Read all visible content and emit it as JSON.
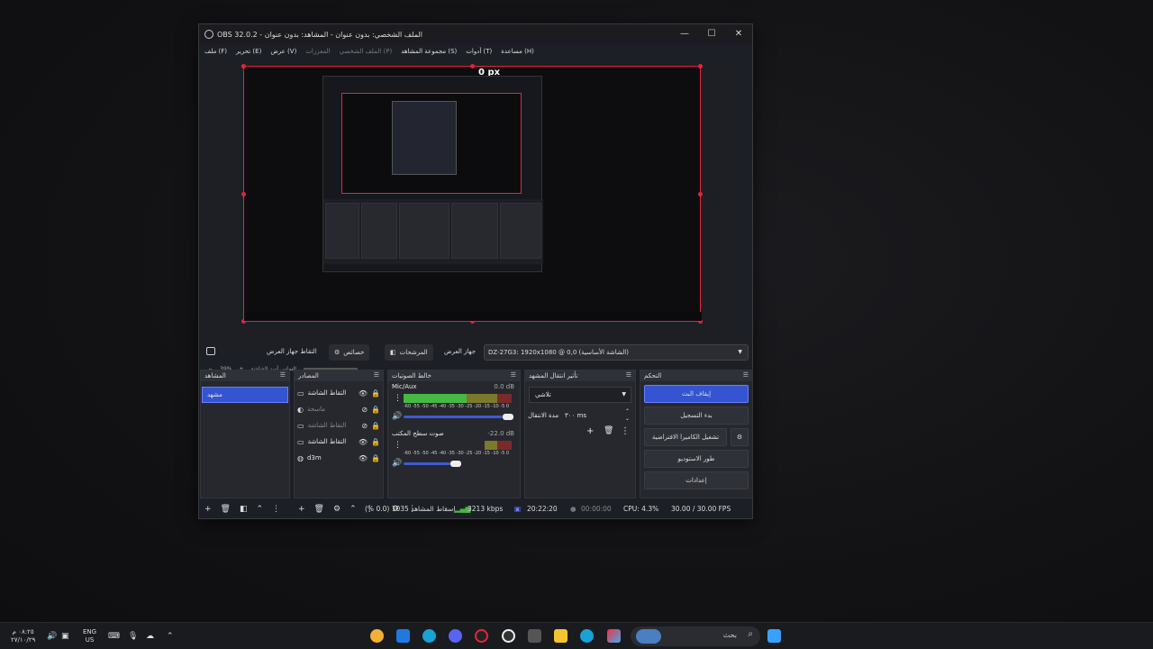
{
  "window": {
    "title": "OBS 32.0.2 - الملف الشخصي: بدون عنوان - المشاهد: بدون عنوان",
    "controls": [
      "—",
      "☐",
      "✕"
    ]
  },
  "menu": [
    {
      "label": "ملف (F)",
      "enabled": true
    },
    {
      "label": "تحرير (E)",
      "enabled": true
    },
    {
      "label": "عرض (V)",
      "enabled": true
    },
    {
      "label": "المعززات",
      "enabled": false
    },
    {
      "label": "الملف الشخصي (P)",
      "enabled": false
    },
    {
      "label": "مجموعة المشاهد (S)",
      "enabled": true
    },
    {
      "label": "أدوات (T)",
      "enabled": true
    },
    {
      "label": "مساعدة (H)",
      "enabled": true
    }
  ],
  "preview": {
    "px_label": "0 px",
    "zoom": "39%",
    "zoom_minus": "−",
    "zoom_plus": "+",
    "zoom_hint": "التماس أسد الشاشة"
  },
  "scene_bar": {
    "capture_label": "التقاط جهاز العرض",
    "properties_label": "خصائص",
    "filters_label": "المرشحات",
    "device_label": "جهاز العرض",
    "device_value": "DZ-27G3: 1920x1080 @ 0,0 (الشاشة الأساسية)"
  },
  "docks": {
    "scenes": {
      "title": "المشاهد",
      "items": [
        "مشهد"
      ]
    },
    "sources": {
      "title": "المصادر",
      "items": [
        {
          "name": "التقاط الشاشة",
          "visible": true,
          "locked": true
        },
        {
          "name": "ماسحة",
          "visible": false,
          "locked": true
        },
        {
          "name": "التقاط الشاشة",
          "visible": false,
          "locked": true
        },
        {
          "name": "التقاط الشاشة",
          "visible": true,
          "locked": true
        },
        {
          "name": "d3m",
          "visible": true,
          "locked": true
        }
      ]
    },
    "mixer": {
      "title": "خالط الصوتيات",
      "channels": [
        {
          "name": "Mic/Aux",
          "db": "0.0 dB",
          "level": 0.7
        },
        {
          "name": "صوت سطح المكتب",
          "db": "-22.0 dB",
          "level": 0.45
        }
      ],
      "scale": "-60 -55 -50 -45 -40 -35 -30 -25 -20 -15 -10 -5 0"
    },
    "transitions": {
      "title": "تأثير انتقال المشهد",
      "type": "تلاشي",
      "duration_label": "مدة الانتقال",
      "duration_value": "٣٠٠ ms"
    },
    "controls": {
      "title": "التحكم",
      "buttons": [
        "إيقاف البث",
        "بدء التسجيل",
        "تشغيل الكاميرا الافتراضية",
        "طور الاستوديو",
        "إعدادات"
      ]
    }
  },
  "status": {
    "dropped": "إسقاط المشاهد 1035 (0.0 %)",
    "bitrate": "3213 kbps",
    "stream_time": "20:22:20",
    "rec_time": "00:00:00",
    "cpu": "CPU: 4.3%",
    "fps": "30.00 / 30.00 FPS"
  },
  "taskbar": {
    "search_placeholder": "بحث",
    "lang_top": "ENG",
    "lang_bottom": "US",
    "time": "٠٨:٢٥ م",
    "date": "٢٧/١٠/٢٩",
    "colors": {
      "chrome": "#f2b134",
      "store": "#1f7ae0",
      "edge": "#1aa2d6",
      "obs": "#e0263d",
      "files": "#f4c430"
    }
  }
}
